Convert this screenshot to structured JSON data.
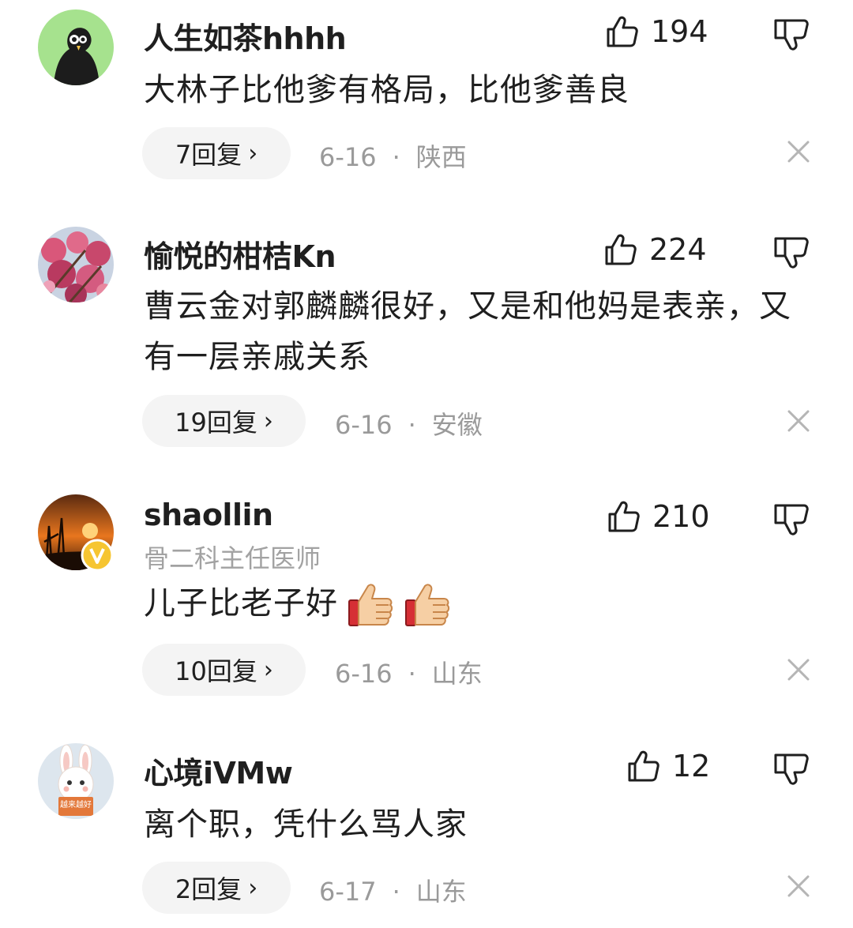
{
  "comments": [
    {
      "username": "人生如茶hhhh",
      "subtitle": "",
      "avatar_icon": "black-bird-avatar",
      "likes": "194",
      "text": "大林子比他爹有格局，比他爹善良",
      "replies_label": "7回复",
      "date": "6-16",
      "location": "陕西"
    },
    {
      "username": "愉悦的柑桔Kn",
      "subtitle": "",
      "avatar_icon": "pink-blossom-avatar",
      "likes": "224",
      "text": "曹云金对郭麟麟很好，又是和他妈是表亲，又有一层亲戚关系",
      "replies_label": "19回复",
      "date": "6-16",
      "location": "安徽"
    },
    {
      "username": "shaollin",
      "subtitle": "骨二科主任医师",
      "avatar_icon": "sunset-avatar",
      "verified_badge": "V",
      "likes": "210",
      "text": "儿子比老子好",
      "emoji": [
        "thumbs-up-emoji",
        "thumbs-up-emoji"
      ],
      "replies_label": "10回复",
      "date": "6-16",
      "location": "山东"
    },
    {
      "username": "心境iVMw",
      "subtitle": "",
      "avatar_icon": "bunny-avatar",
      "avatar_sign_text": "越来越好",
      "likes": "12",
      "text": "离个职，凭什么骂人家",
      "replies_label": "2回复",
      "date": "6-17",
      "location": "山东"
    }
  ],
  "chevron": "›",
  "separator": "·"
}
